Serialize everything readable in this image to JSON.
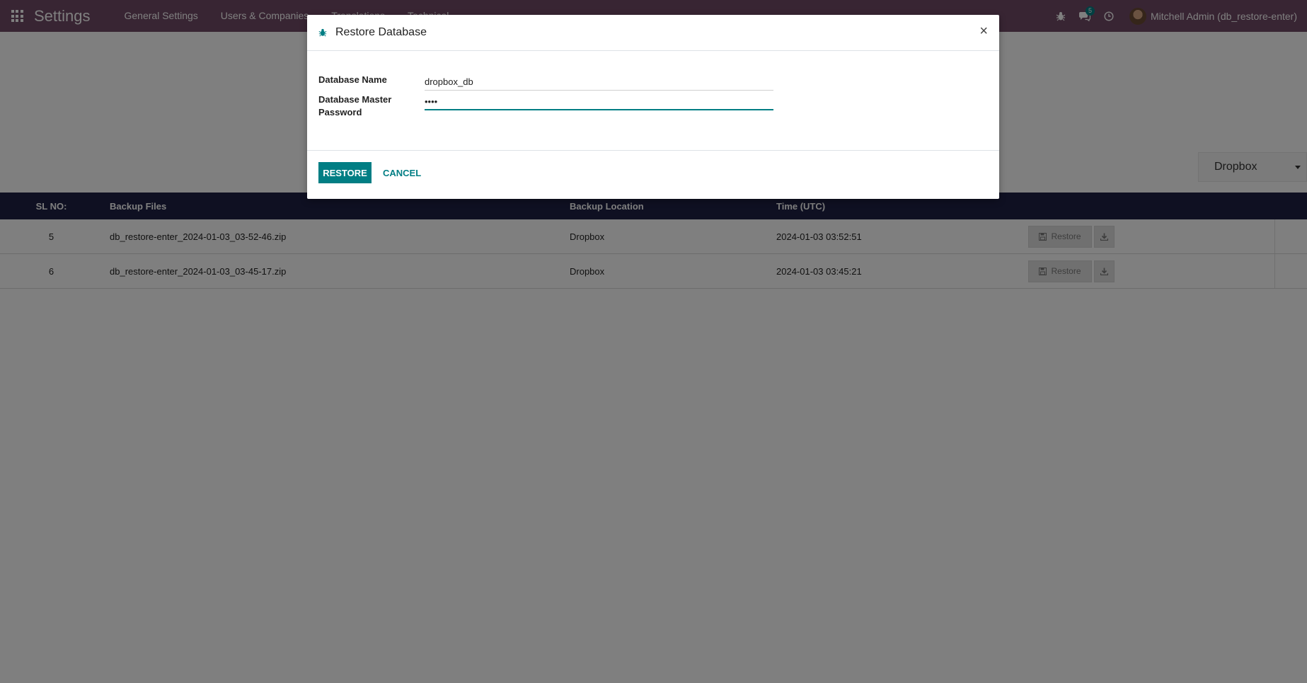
{
  "navbar": {
    "brand": "Settings",
    "menu": [
      "General Settings",
      "Users & Companies",
      "Translations",
      "Technical"
    ],
    "chat_badge": "5",
    "user_name": "Mitchell Admin (db_restore-enter)"
  },
  "page": {
    "dropdown_value": "Dropbox",
    "table": {
      "headers": [
        "SL NO:",
        "Backup Files",
        "Backup Location",
        "Time (UTC)"
      ],
      "rows": [
        {
          "sl": "5",
          "file": "db_restore-enter_2024-01-03_03-52-46.zip",
          "location": "Dropbox",
          "time": "2024-01-03 03:52:51",
          "restore_label": "Restore"
        },
        {
          "sl": "6",
          "file": "db_restore-enter_2024-01-03_03-45-17.zip",
          "location": "Dropbox",
          "time": "2024-01-03 03:45:21",
          "restore_label": "Restore"
        }
      ]
    }
  },
  "modal": {
    "title": "Restore Database",
    "close": "×",
    "fields": {
      "db_name_label": "Database Name",
      "db_name_value": "dropbox_db",
      "master_pwd_label": "Database Master Password",
      "master_pwd_value": "••••"
    },
    "restore_button": "RESTORE",
    "cancel_button": "CANCEL"
  },
  "colors": {
    "navbar": "#714B67",
    "primary": "#017e84",
    "table_header": "#1e2044"
  }
}
